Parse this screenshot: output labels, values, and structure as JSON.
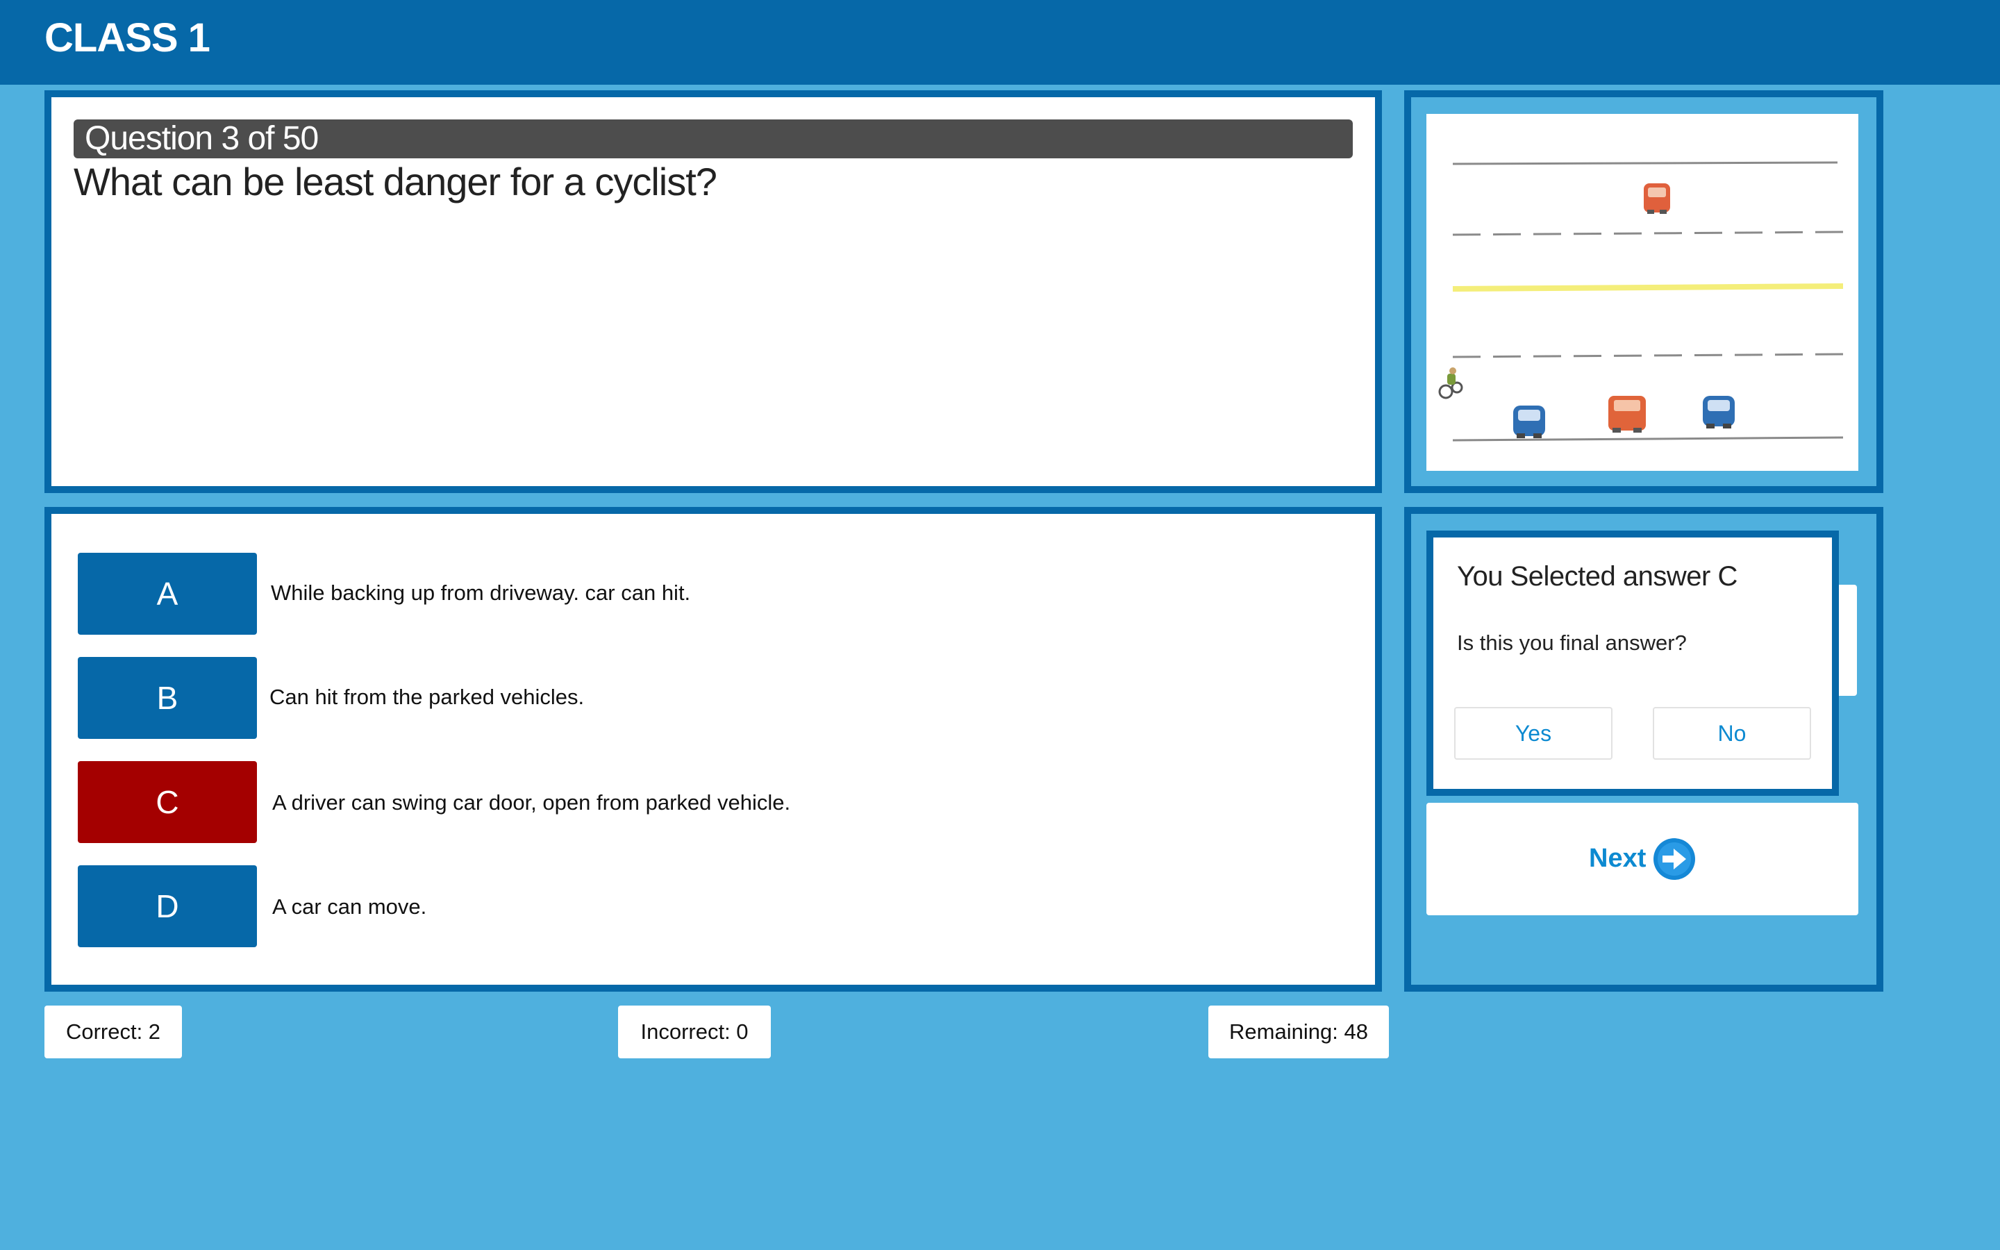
{
  "header": {
    "title": "CLASS 1"
  },
  "question": {
    "counter": "Question 3 of 50",
    "text": "What can be least danger for a cyclist?"
  },
  "answers": [
    {
      "letter": "A",
      "text": "While backing up from driveway. car can hit."
    },
    {
      "letter": "B",
      "text": "Can hit from the parked vehicles."
    },
    {
      "letter": "C",
      "text": "A driver can swing car door, open from parked vehicle."
    },
    {
      "letter": "D",
      "text": "A car can move."
    }
  ],
  "selected_answer": "C",
  "confirm": {
    "title": "You Selected answer C",
    "question": "Is this you final answer?",
    "yes_label": "Yes",
    "no_label": "No"
  },
  "next": {
    "label": "Next"
  },
  "score": {
    "correct": "Correct: 2",
    "incorrect": "Incorrect: 0",
    "remaining": "Remaining: 48"
  },
  "colors": {
    "background": "#4fb0de",
    "header": "#0668a8",
    "answer_button": "#0668a8",
    "answer_selected": "#a40000",
    "accent": "#0d8ad1"
  },
  "icons": {
    "next": "arrow-right-circle-icon"
  }
}
